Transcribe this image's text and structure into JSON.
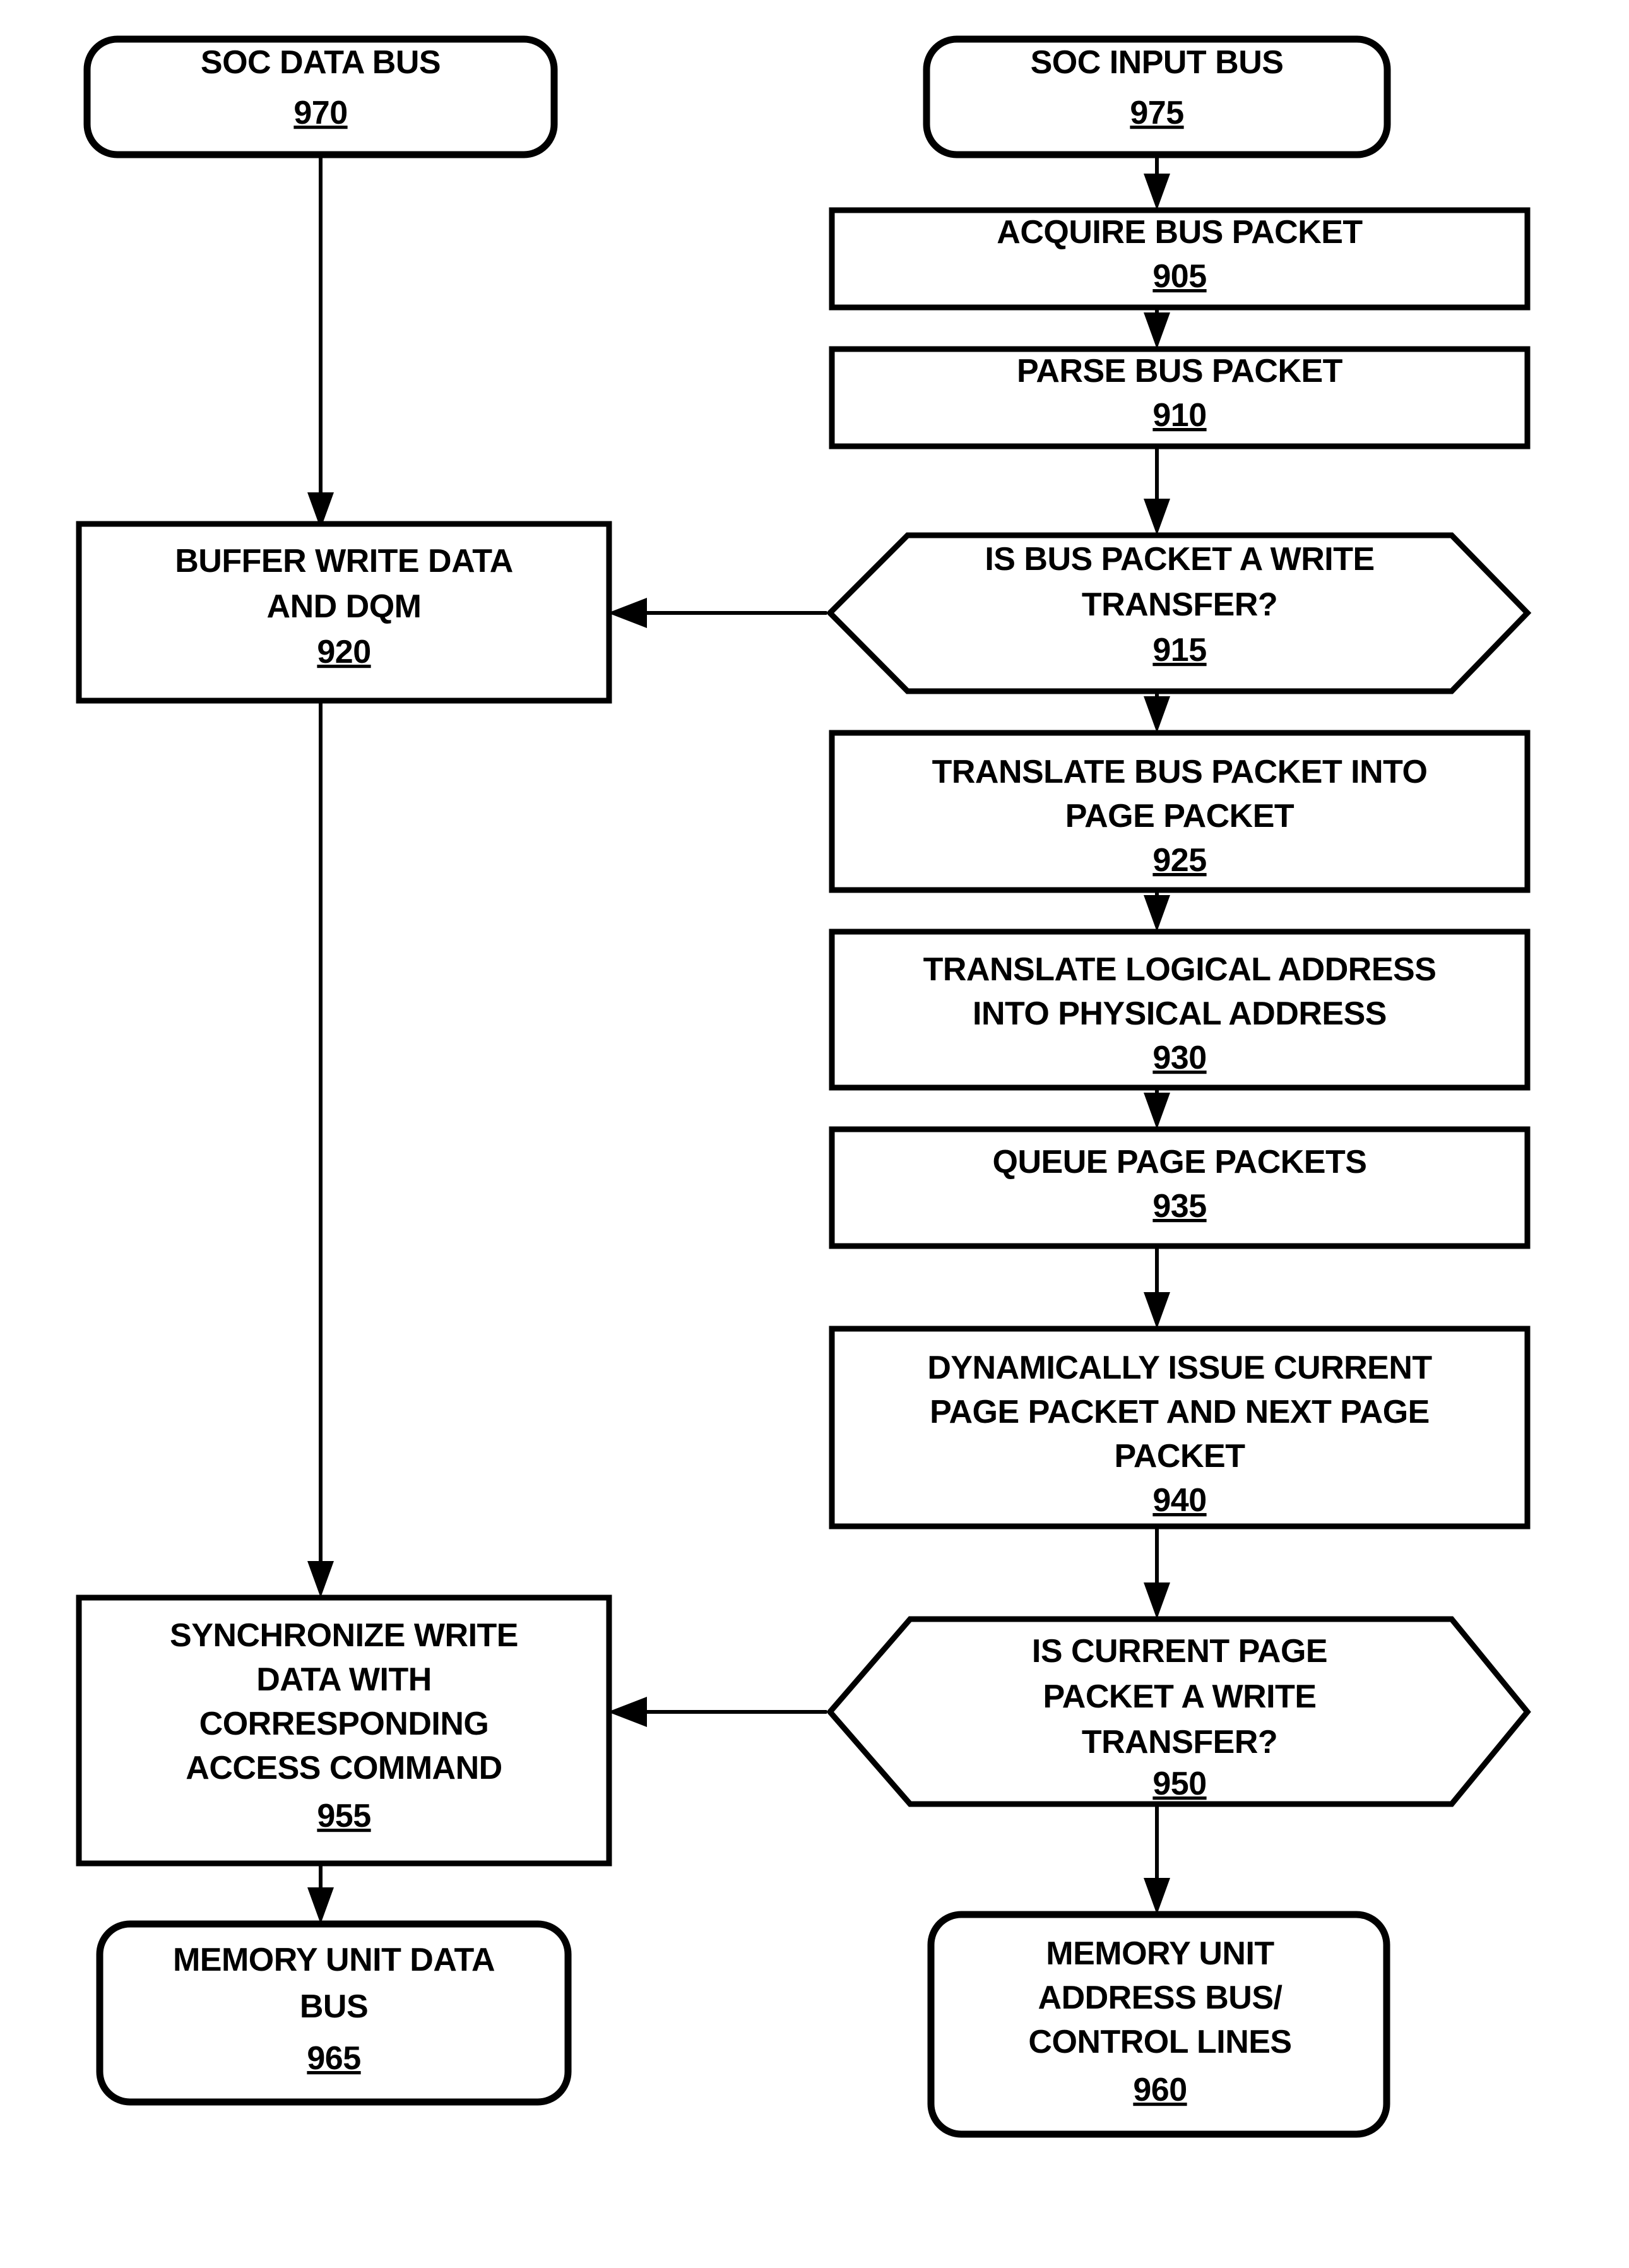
{
  "diagram": {
    "type": "flowchart",
    "title": "",
    "nodes": [
      {
        "id": "n970",
        "shape": "terminal-rounded",
        "lines": [
          "SOC DATA BUS"
        ],
        "ref": "970",
        "column": "left"
      },
      {
        "id": "n975",
        "shape": "terminal-rounded",
        "lines": [
          "SOC INPUT BUS"
        ],
        "ref": "975",
        "column": "right"
      },
      {
        "id": "n905",
        "shape": "process-rect",
        "lines": [
          "ACQUIRE BUS PACKET"
        ],
        "ref": "905",
        "column": "right"
      },
      {
        "id": "n910",
        "shape": "process-rect",
        "lines": [
          "PARSE BUS PACKET"
        ],
        "ref": "910",
        "column": "right"
      },
      {
        "id": "n915",
        "shape": "decision-hexagon",
        "lines": [
          "IS BUS PACKET A WRITE",
          "TRANSFER?"
        ],
        "ref": "915",
        "column": "right"
      },
      {
        "id": "n920",
        "shape": "process-rect",
        "lines": [
          "BUFFER WRITE DATA",
          "AND DQM"
        ],
        "ref": "920",
        "column": "left"
      },
      {
        "id": "n925",
        "shape": "process-rect",
        "lines": [
          "TRANSLATE BUS PACKET INTO",
          "PAGE PACKET"
        ],
        "ref": "925",
        "column": "right"
      },
      {
        "id": "n930",
        "shape": "process-rect",
        "lines": [
          "TRANSLATE LOGICAL ADDRESS",
          "INTO PHYSICAL ADDRESS"
        ],
        "ref": "930",
        "column": "right"
      },
      {
        "id": "n935",
        "shape": "process-rect",
        "lines": [
          "QUEUE PAGE PACKETS"
        ],
        "ref": "935",
        "column": "right"
      },
      {
        "id": "n940",
        "shape": "process-rect",
        "lines": [
          "DYNAMICALLY ISSUE CURRENT",
          "PAGE PACKET AND NEXT PAGE",
          "PACKET"
        ],
        "ref": "940",
        "column": "right"
      },
      {
        "id": "n950",
        "shape": "decision-hexagon",
        "lines": [
          "IS CURRENT PAGE",
          "PACKET A WRITE",
          "TRANSFER?"
        ],
        "ref": "950",
        "column": "right"
      },
      {
        "id": "n955",
        "shape": "process-rect",
        "lines": [
          "SYNCHRONIZE WRITE",
          "DATA WITH",
          "CORRESPONDING",
          "ACCESS COMMAND"
        ],
        "ref": "955",
        "column": "left"
      },
      {
        "id": "n960",
        "shape": "terminal-rounded",
        "lines": [
          "MEMORY UNIT",
          "ADDRESS BUS/",
          "CONTROL LINES"
        ],
        "ref": "960",
        "column": "right"
      },
      {
        "id": "n965",
        "shape": "terminal-rounded",
        "lines": [
          "MEMORY UNIT DATA",
          "BUS"
        ],
        "ref": "965",
        "column": "left"
      }
    ],
    "edges": [
      {
        "from": "n970",
        "to": "n920",
        "direction": "down"
      },
      {
        "from": "n975",
        "to": "n905",
        "direction": "down"
      },
      {
        "from": "n905",
        "to": "n910",
        "direction": "down"
      },
      {
        "from": "n910",
        "to": "n915",
        "direction": "down"
      },
      {
        "from": "n915",
        "to": "n920",
        "direction": "left"
      },
      {
        "from": "n915",
        "to": "n925",
        "direction": "down"
      },
      {
        "from": "n925",
        "to": "n930",
        "direction": "down"
      },
      {
        "from": "n930",
        "to": "n935",
        "direction": "down"
      },
      {
        "from": "n935",
        "to": "n940",
        "direction": "down"
      },
      {
        "from": "n940",
        "to": "n950",
        "direction": "down"
      },
      {
        "from": "n950",
        "to": "n955",
        "direction": "left"
      },
      {
        "from": "n950",
        "to": "n960",
        "direction": "down"
      },
      {
        "from": "n920",
        "to": "n955",
        "direction": "down"
      },
      {
        "from": "n955",
        "to": "n965",
        "direction": "down"
      }
    ],
    "colors": {
      "stroke": "#000000",
      "fill": "#ffffff",
      "text": "#000000"
    }
  }
}
